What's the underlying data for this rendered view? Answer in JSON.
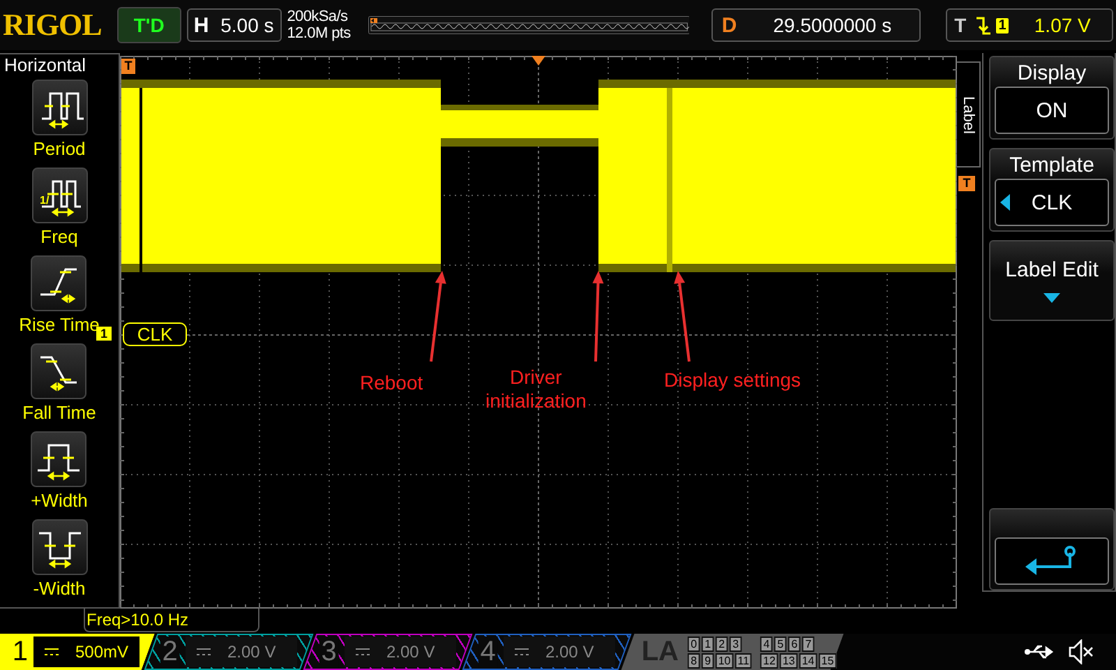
{
  "top_bar": {
    "logo": "RIGOL",
    "run_status": "T'D",
    "horizontal": {
      "label": "H",
      "value": "5.00 s"
    },
    "sample_rate": "200kSa/s",
    "memory_depth": "12.0M pts",
    "delay": {
      "label": "D",
      "value": "29.5000000 s"
    },
    "trigger": {
      "label": "T",
      "source": "1",
      "level": "1.07 V"
    }
  },
  "left_menu": {
    "title": "Horizontal",
    "items": [
      {
        "kind": "period",
        "label": "Period"
      },
      {
        "kind": "freq",
        "label": "Freq",
        "icon_text": "1/"
      },
      {
        "kind": "rise",
        "label": "Rise Time"
      },
      {
        "kind": "fall",
        "label": "Fall Time"
      },
      {
        "kind": "pwidth",
        "label": "+Width"
      },
      {
        "kind": "nwidth",
        "label": "-Width"
      }
    ]
  },
  "plot": {
    "channel_marker": "1",
    "channel_label": "CLK",
    "label_tab": "Label",
    "trigger_marker": "T",
    "position_marker": "T",
    "annotations": [
      {
        "text": "Reboot"
      },
      {
        "text": "Driver\ninitialization"
      },
      {
        "text": "Display settings"
      }
    ]
  },
  "right_menu": [
    {
      "kind": "value",
      "title": "Display",
      "value": "ON"
    },
    {
      "kind": "select",
      "title": "Template",
      "value": "CLK"
    },
    {
      "kind": "submenu",
      "title": "Label Edit"
    },
    {
      "kind": "back"
    }
  ],
  "freq_readout": "Freq>10.0 Hz",
  "channels": [
    {
      "number": "1",
      "scale": "500mV",
      "on": true,
      "color": "#ffff00"
    },
    {
      "number": "2",
      "scale": "2.00 V",
      "on": false,
      "color": "#00a0a0"
    },
    {
      "number": "3",
      "scale": "2.00 V",
      "on": false,
      "color": "#c000c0"
    },
    {
      "number": "4",
      "scale": "2.00 V",
      "on": false,
      "color": "#2060c0"
    }
  ],
  "la": {
    "label": "LA",
    "bits": [
      [
        "0",
        "1",
        "2",
        "3"
      ],
      [
        "4",
        "5",
        "6",
        "7"
      ],
      [
        "8",
        "9",
        "10",
        "11"
      ],
      [
        "12",
        "13",
        "14",
        "15"
      ]
    ]
  }
}
